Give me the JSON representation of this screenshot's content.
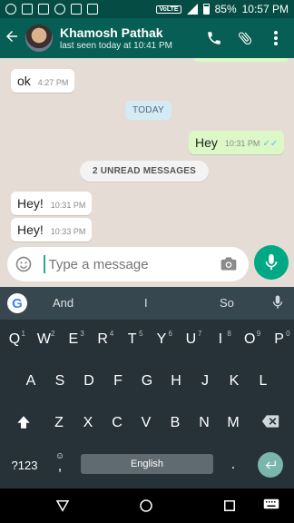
{
  "status_bar": {
    "volte": "VoLTE",
    "battery": "85%",
    "time": "10:57 PM"
  },
  "header": {
    "back_icon": "arrow-left-icon",
    "contact_name": "Khamosh Pathak",
    "last_seen": "last seen today at 10:41 PM",
    "actions": [
      "phone-icon",
      "attachment-icon",
      "more-vert-icon"
    ]
  },
  "chat": {
    "messages": [
      {
        "text": "ok",
        "time": "4:27 PM",
        "direction": "in"
      },
      {
        "text": "Hey",
        "time": "10:31 PM",
        "direction": "out",
        "read": true
      },
      {
        "text": "Hey!",
        "time": "10:31 PM",
        "direction": "in"
      },
      {
        "text": "Hey!",
        "time": "10:33 PM",
        "direction": "in"
      }
    ],
    "date_badge": "TODAY",
    "unread_badge": "2 UNREAD MESSAGES"
  },
  "composer": {
    "placeholder": "Type a message"
  },
  "keyboard": {
    "suggestions": [
      "And",
      "I",
      "So"
    ],
    "row1": [
      "Q",
      "W",
      "E",
      "R",
      "T",
      "Y",
      "U",
      "I",
      "O",
      "P"
    ],
    "row1_hints": [
      "1",
      "2",
      "3",
      "4",
      "5",
      "6",
      "7",
      "8",
      "9",
      "0"
    ],
    "row2": [
      "A",
      "S",
      "D",
      "F",
      "G",
      "H",
      "J",
      "K",
      "L"
    ],
    "row3": [
      "Z",
      "X",
      "C",
      "V",
      "B",
      "N",
      "M"
    ],
    "symbols_key": "?123",
    "comma_key": ",",
    "period_key": ".",
    "space_label": "English"
  },
  "colors": {
    "header": "#075e54",
    "statusbar": "#054d44",
    "outgoing": "#dcf8c6",
    "accent": "#00a884",
    "read_ticks": "#4fc3f7"
  }
}
